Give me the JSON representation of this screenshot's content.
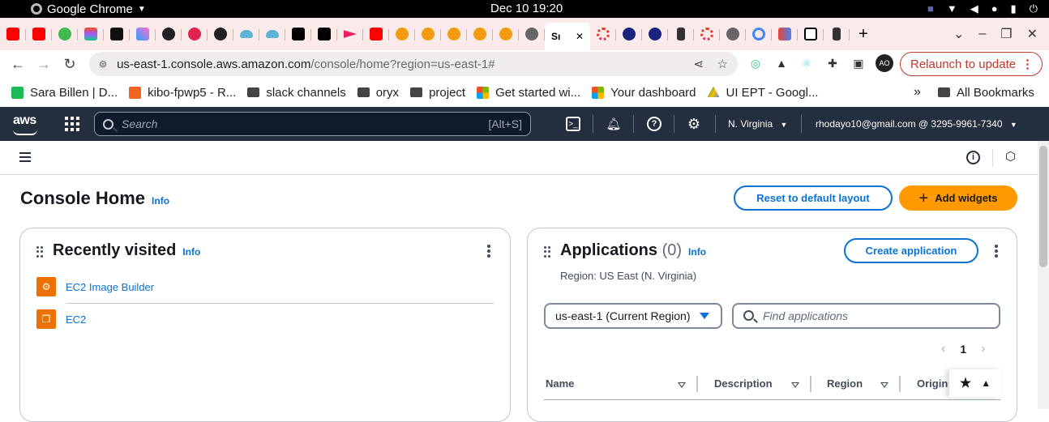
{
  "os_bar": {
    "app_name": "Google Chrome",
    "clock": "Dec 10  19:20"
  },
  "tabs": {
    "active_tab_label": "Sı",
    "close_glyph": "✕",
    "new_tab_glyph": "+"
  },
  "address_bar": {
    "host": "us-east-1.console.aws.amazon.com",
    "path": "/console/home?region=us-east-1#",
    "profile_initials": "AO",
    "relaunch_label": "Relaunch to update"
  },
  "bookmarks": {
    "items": [
      {
        "label": "Sara Billen | D...",
        "icon_color": "#1db954"
      },
      {
        "label": "kibo-fpwp5 - R...",
        "icon_color": "#f26522"
      },
      {
        "label": "slack channels",
        "icon_color": "#444444"
      },
      {
        "label": "oryx",
        "icon_color": "#444444"
      },
      {
        "label": "project",
        "icon_color": "#444444"
      },
      {
        "label": "Get started wi...",
        "icon_color": "#f25022"
      },
      {
        "label": "Your dashboard",
        "icon_color": "#f25022"
      },
      {
        "label": "UI EPT - Googl...",
        "icon_color": "#fbbc04"
      }
    ],
    "overflow": "»",
    "all_bookmarks": "All Bookmarks"
  },
  "aws_header": {
    "logo": "aws",
    "search_placeholder": "Search",
    "search_shortcut": "[Alt+S]",
    "region": "N. Virginia",
    "account": "rhodayo10@gmail.com @ 3295-9961-7340"
  },
  "page": {
    "title": "Console Home",
    "info": "Info",
    "reset_button": "Reset to default layout",
    "add_widgets_button": "Add widgets"
  },
  "recently_visited": {
    "title": "Recently visited",
    "info": "Info",
    "items": [
      {
        "label": "EC2 Image Builder",
        "icon": "ec2-image-builder-icon"
      },
      {
        "label": "EC2",
        "icon": "ec2-icon"
      }
    ]
  },
  "applications": {
    "title": "Applications",
    "count": "(0)",
    "info": "Info",
    "create_button": "Create application",
    "region_text": "Region: US East (N. Virginia)",
    "region_select": "us-east-1 (Current Region)",
    "find_placeholder": "Find applications",
    "page_number": "1",
    "columns": [
      "Name",
      "Description",
      "Region",
      "Origin"
    ]
  },
  "colors": {
    "aws_nav": "#232f3e",
    "link": "#0972d3",
    "primary": "#ff9900",
    "service_orange": "#ed7100"
  }
}
